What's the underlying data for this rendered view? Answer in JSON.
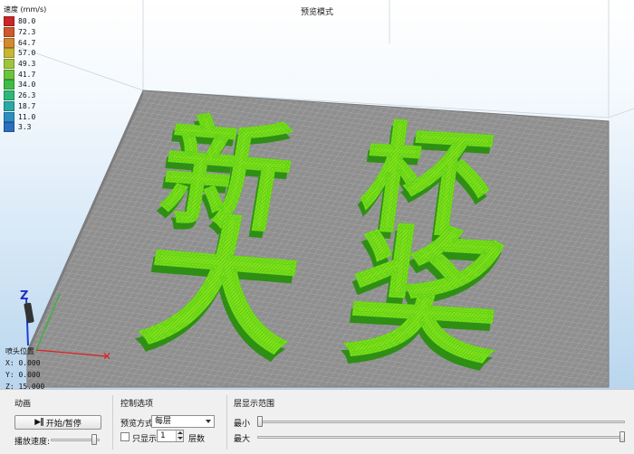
{
  "viewport": {
    "title": "预览模式"
  },
  "legend": {
    "title": "速度 (mm/s)",
    "entries": [
      {
        "value": "80.0",
        "color": "#c8262a"
      },
      {
        "value": "72.3",
        "color": "#cc5a2c"
      },
      {
        "value": "64.7",
        "color": "#d18a2e"
      },
      {
        "value": "57.0",
        "color": "#c7b536"
      },
      {
        "value": "49.3",
        "color": "#9fc43a"
      },
      {
        "value": "41.7",
        "color": "#6bc43e"
      },
      {
        "value": "34.0",
        "color": "#3dbd45"
      },
      {
        "value": "26.3",
        "color": "#2fb77a"
      },
      {
        "value": "18.7",
        "color": "#2aa9a5"
      },
      {
        "value": "11.0",
        "color": "#2a8fc2"
      },
      {
        "value": "3.3",
        "color": "#2b6dc0"
      }
    ]
  },
  "axis": {
    "z_label": "Z"
  },
  "model": {
    "characters": [
      "新",
      "杯",
      "大",
      "奖"
    ],
    "top_color": "#7fe21a",
    "side_color": "#2e8f14"
  },
  "nozzle": {
    "title": "喷头位置",
    "x": "X: 0.000",
    "y": "Y: 0.000",
    "z": "Z: 15.000"
  },
  "panel": {
    "animation": {
      "title": "动画",
      "play_label": "开始/暂停",
      "speed_label": "播放速度:",
      "speed_fraction": 0.93
    },
    "control": {
      "title": "控制选项",
      "mode_label": "预览方式",
      "mode_value": "每层",
      "only_show_label": "只显示",
      "only_show_checked": false,
      "layer_value": "1",
      "layer_unit": "层数"
    },
    "layer_range": {
      "title": "层显示范围",
      "min_label": "最小",
      "max_label": "最大",
      "min_fraction": 0.0,
      "max_fraction": 1.0
    }
  }
}
